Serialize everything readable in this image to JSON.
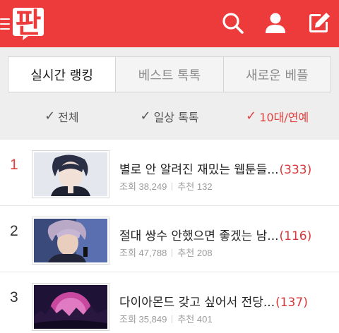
{
  "header": {
    "logo_text": "판",
    "search_icon": "search-icon",
    "profile_icon": "user-icon",
    "write_icon": "write-icon",
    "brand_color": "#ed3b3b"
  },
  "tabs": [
    {
      "label": "실시간 랭킹",
      "active": true
    },
    {
      "label": "베스트 톡톡",
      "active": false
    },
    {
      "label": "새로운 베플",
      "active": false
    }
  ],
  "filters": [
    {
      "label": "전체",
      "active": false
    },
    {
      "label": "일상 톡톡",
      "active": false
    },
    {
      "label": "10대/연예",
      "active": true
    }
  ],
  "posts": [
    {
      "rank": "1",
      "title": "별로 안 알려진 재밌는 웹툰들...",
      "comments": "(333)",
      "views_label": "조회",
      "views": "38,249",
      "recommend_label": "추천",
      "recommend": "132"
    },
    {
      "rank": "2",
      "title": "절대 쌍수 안했으면 좋겠는 남...",
      "comments": "(116)",
      "views_label": "조회",
      "views": "47,788",
      "recommend_label": "추천",
      "recommend": "208"
    },
    {
      "rank": "3",
      "title": "다이아몬드 갖고 싶어서 전당...",
      "comments": "(137)",
      "views_label": "조회",
      "views": "35,849",
      "recommend_label": "추천",
      "recommend": "401"
    }
  ],
  "colors": {
    "accent": "#e0413f",
    "tab_area_bg": "#eeeeee"
  }
}
